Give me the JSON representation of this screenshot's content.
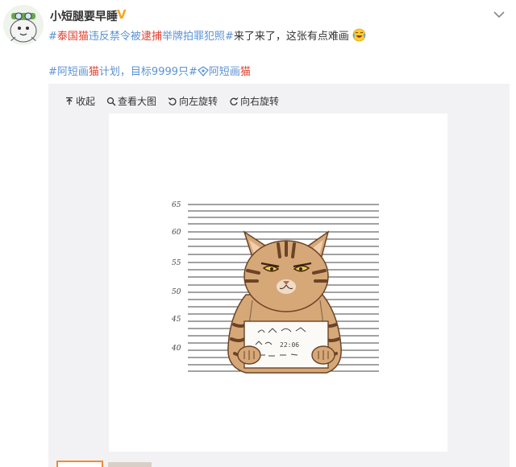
{
  "author": {
    "name": "小短腿要早睡",
    "badge": "V"
  },
  "post": {
    "line1": [
      {
        "text": "#",
        "style": "topic"
      },
      {
        "text": "泰国猫",
        "style": "red"
      },
      {
        "text": "违反禁令被",
        "style": "topic"
      },
      {
        "text": "逮捕",
        "style": "red"
      },
      {
        "text": "举牌拍罪犯照#",
        "style": "topic"
      },
      {
        "text": "来了来了，这张有点难画",
        "style": "txt"
      }
    ],
    "line2": [
      {
        "text": "#阿短画",
        "style": "topic"
      },
      {
        "text": "猫",
        "style": "red"
      },
      {
        "text": "计划，目标9999只#",
        "style": "topic"
      },
      {
        "text": "阿短画",
        "style": "topic"
      },
      {
        "text": "猫",
        "style": "red"
      }
    ]
  },
  "toolbar": {
    "collapse": "收起",
    "view_large": "查看大图",
    "rotate_left": "向左旋转",
    "rotate_right": "向右旋转"
  },
  "photo": {
    "height_marks": [
      "65",
      "60",
      "55",
      "50",
      "45",
      "40"
    ],
    "sign_text": "22:06"
  },
  "colors": {
    "topic": "#5b93d3",
    "highlight": "#e33e2c",
    "vip_badge": "#f5a623",
    "media_bg": "#f2f2f5",
    "cat_fur": "#d6a878",
    "cat_stripe": "#6b4326"
  },
  "icons": [
    "avatar",
    "chevron-down-icon",
    "laugh-cry-emoji",
    "super-topic-icon",
    "collapse-icon",
    "magnifier-icon",
    "rotate-left-icon",
    "rotate-right-icon"
  ]
}
